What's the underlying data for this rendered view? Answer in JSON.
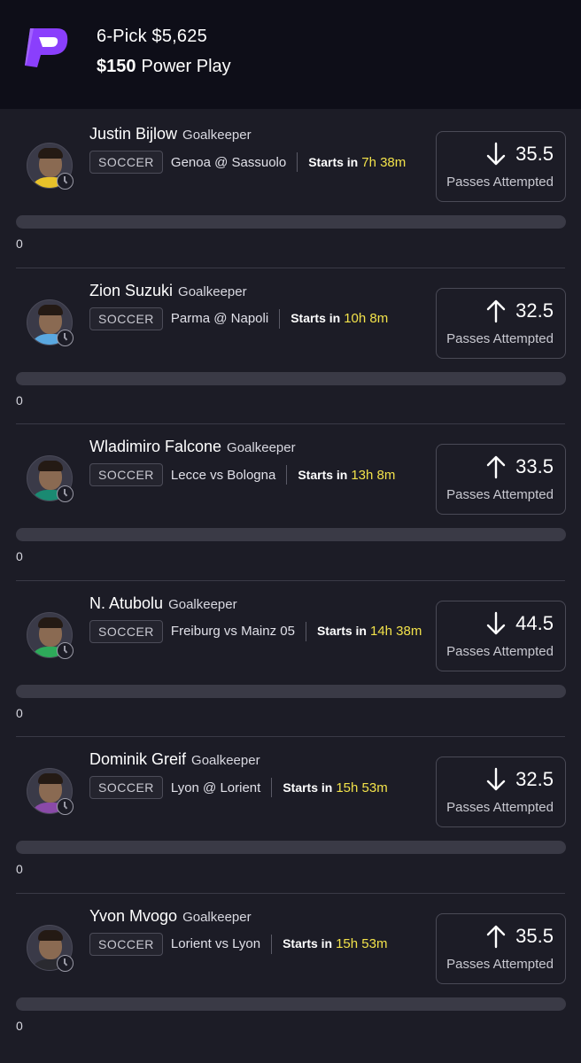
{
  "header": {
    "entry_line": "6-Pick $5,625",
    "wager_amount": "$150",
    "play_type": "Power Play",
    "brand_color": "#8a3ffc"
  },
  "picks": [
    {
      "name": "Justin Bijlow",
      "position": "Goalkeeper",
      "sport": "SOCCER",
      "matchup": "Genoa @ Sassuolo",
      "starts_label": "Starts in",
      "starts_time": "7h 38m",
      "direction": "down",
      "line": "35.5",
      "stat": "Passes Attempted",
      "progress": 0,
      "progress_label": "0",
      "shirt_color": "#e8c22a"
    },
    {
      "name": "Zion Suzuki",
      "position": "Goalkeeper",
      "sport": "SOCCER",
      "matchup": "Parma @ Napoli",
      "starts_label": "Starts in",
      "starts_time": "10h 8m",
      "direction": "up",
      "line": "32.5",
      "stat": "Passes Attempted",
      "progress": 0,
      "progress_label": "0",
      "shirt_color": "#5aa8e0"
    },
    {
      "name": "Wladimiro Falcone",
      "position": "Goalkeeper",
      "sport": "SOCCER",
      "matchup": "Lecce vs Bologna",
      "starts_label": "Starts in",
      "starts_time": "13h 8m",
      "direction": "up",
      "line": "33.5",
      "stat": "Passes Attempted",
      "progress": 0,
      "progress_label": "0",
      "shirt_color": "#1a8a72"
    },
    {
      "name": "N. Atubolu",
      "position": "Goalkeeper",
      "sport": "SOCCER",
      "matchup": "Freiburg vs Mainz 05",
      "starts_label": "Starts in",
      "starts_time": "14h 38m",
      "direction": "down",
      "line": "44.5",
      "stat": "Passes Attempted",
      "progress": 0,
      "progress_label": "0",
      "shirt_color": "#2eaa5a"
    },
    {
      "name": "Dominik Greif",
      "position": "Goalkeeper",
      "sport": "SOCCER",
      "matchup": "Lyon @ Lorient",
      "starts_label": "Starts in",
      "starts_time": "15h 53m",
      "direction": "down",
      "line": "32.5",
      "stat": "Passes Attempted",
      "progress": 0,
      "progress_label": "0",
      "shirt_color": "#8a4aa8"
    },
    {
      "name": "Yvon Mvogo",
      "position": "Goalkeeper",
      "sport": "SOCCER",
      "matchup": "Lorient vs Lyon",
      "starts_label": "Starts in",
      "starts_time": "15h 53m",
      "direction": "up",
      "line": "35.5",
      "stat": "Passes Attempted",
      "progress": 0,
      "progress_label": "0",
      "shirt_color": "#2a2a30"
    }
  ]
}
